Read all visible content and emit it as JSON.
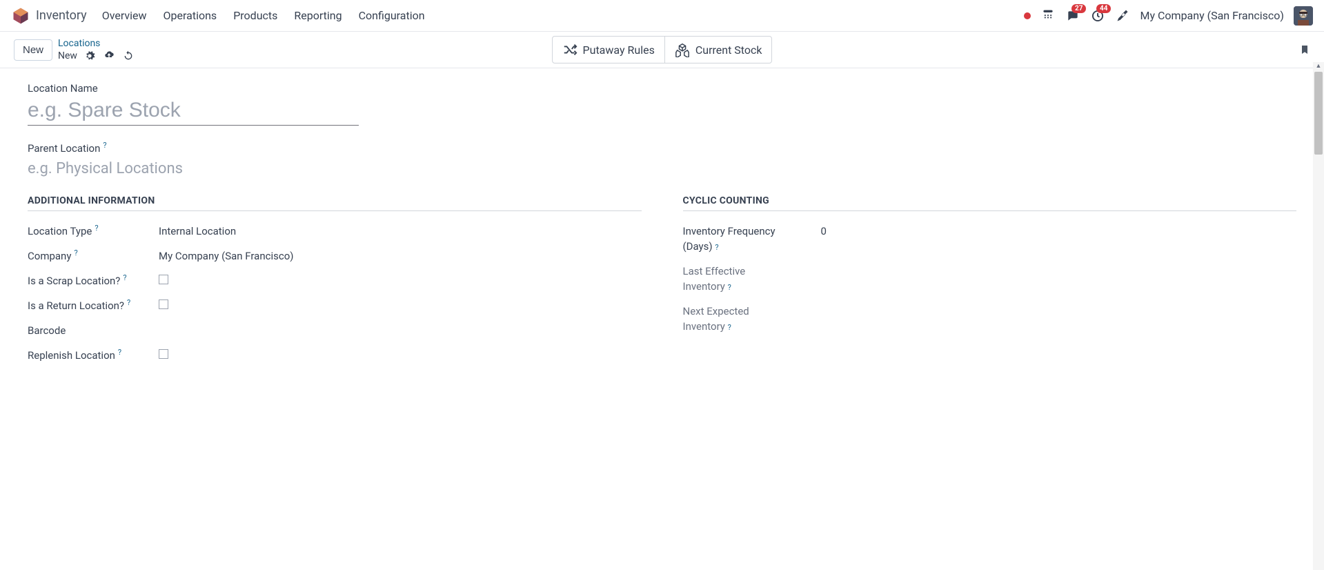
{
  "header": {
    "app_title": "Inventory",
    "nav": [
      "Overview",
      "Operations",
      "Products",
      "Reporting",
      "Configuration"
    ],
    "messages_badge": "27",
    "activities_badge": "44",
    "company": "My Company (San Francisco)"
  },
  "control": {
    "new_button": "New",
    "breadcrumb_parent": "Locations",
    "breadcrumb_current": "New",
    "stat_buttons": {
      "putaway": "Putaway Rules",
      "stock": "Current Stock"
    }
  },
  "form": {
    "name_label": "Location Name",
    "name_placeholder": "e.g. Spare Stock",
    "parent_label": "Parent Location",
    "parent_placeholder": "e.g. Physical Locations",
    "sections": {
      "additional": {
        "title": "ADDITIONAL INFORMATION",
        "fields": {
          "location_type": {
            "label": "Location Type",
            "value": "Internal Location"
          },
          "company": {
            "label": "Company",
            "value": "My Company (San Francisco)"
          },
          "scrap": {
            "label": "Is a Scrap Location?"
          },
          "return": {
            "label": "Is a Return Location?"
          },
          "barcode": {
            "label": "Barcode"
          },
          "replenish": {
            "label": "Replenish Location"
          }
        }
      },
      "cyclic": {
        "title": "CYCLIC COUNTING",
        "fields": {
          "frequency": {
            "label_l1": "Inventory Frequency",
            "label_l2": "(Days)",
            "value": "0"
          },
          "last": {
            "label_l1": "Last Effective",
            "label_l2": "Inventory"
          },
          "next": {
            "label_l1": "Next Expected",
            "label_l2": "Inventory"
          }
        }
      }
    }
  },
  "help": "?"
}
